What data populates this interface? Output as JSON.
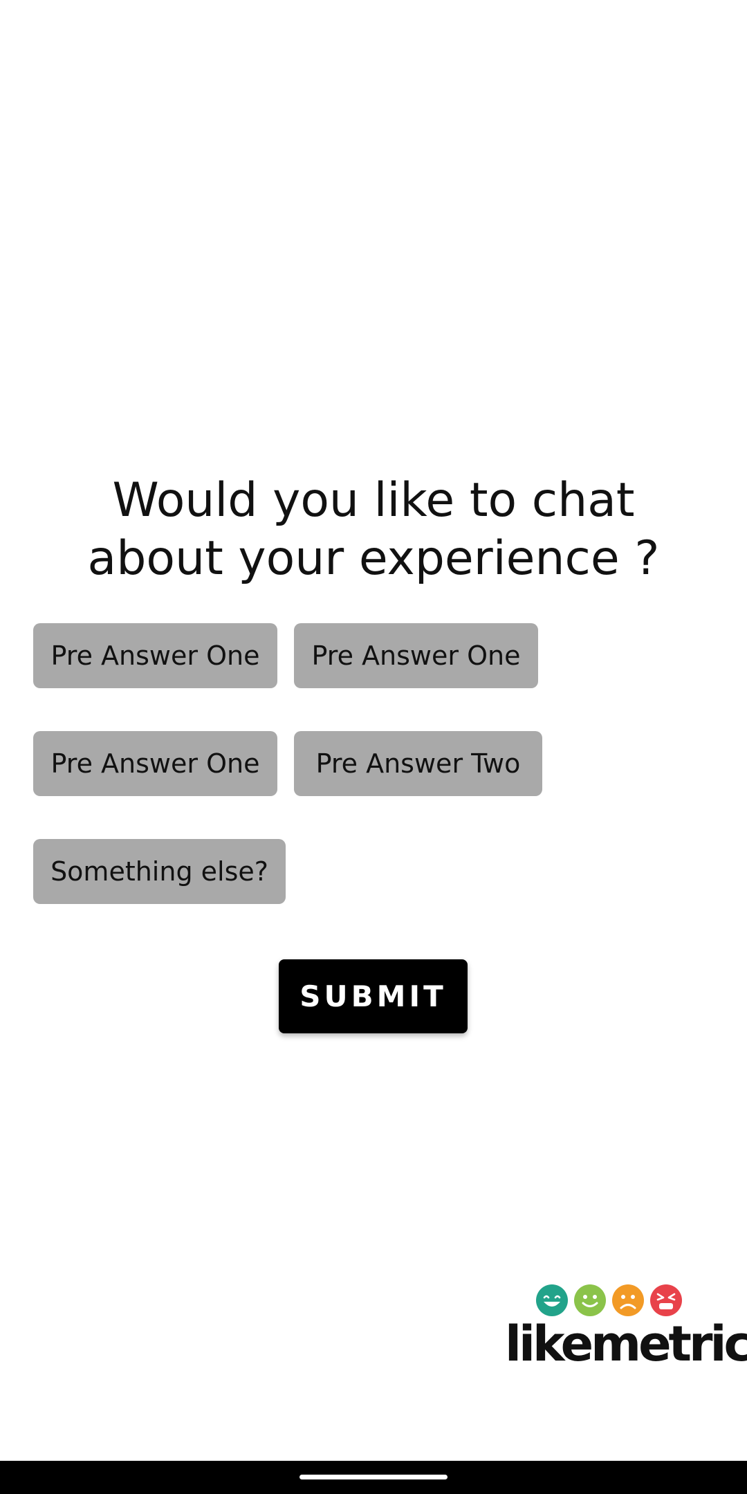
{
  "survey": {
    "question": "Would you like to chat about your experience ?",
    "answers": [
      "Pre Answer One",
      "Pre Answer One",
      "Pre Answer One",
      "Pre Answer Two",
      "Something else?"
    ],
    "submit_label": "SUBMIT"
  },
  "brand": {
    "wordmark": "likemetric",
    "faces": [
      "very-happy-face-icon",
      "happy-face-icon",
      "sad-face-icon",
      "angry-face-icon"
    ],
    "face_colors": [
      "#22a38a",
      "#8bc34a",
      "#f29a26",
      "#e8424a"
    ]
  },
  "colors": {
    "chip_background": "#a9a9a9",
    "submit_background": "#000000",
    "submit_text": "#ffffff"
  }
}
